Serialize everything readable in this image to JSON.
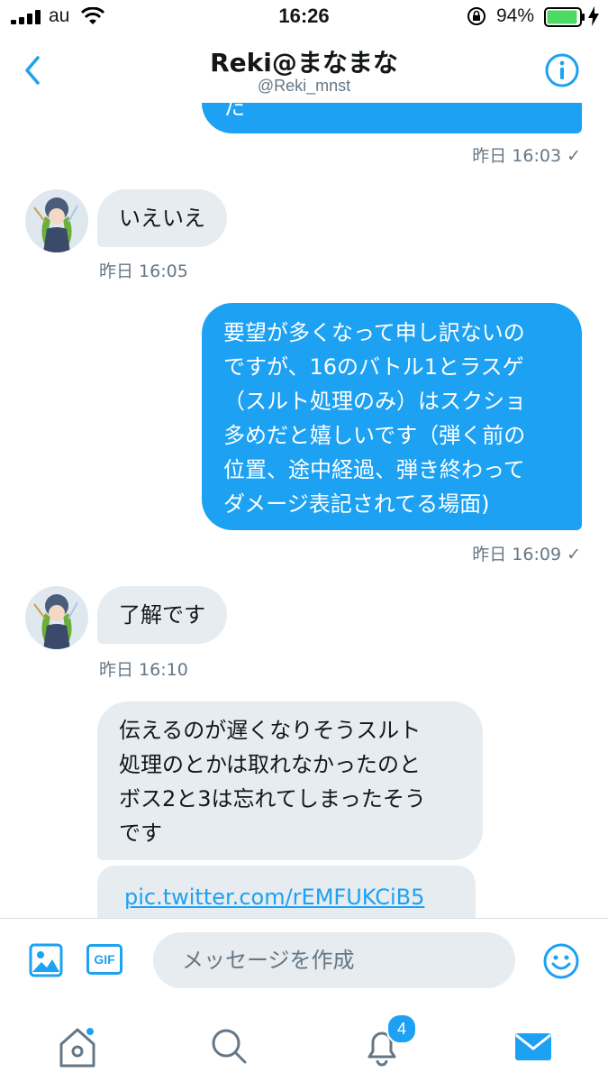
{
  "status_bar": {
    "carrier": "au",
    "time": "16:26",
    "battery_percent": "94%",
    "battery_level": 0.94
  },
  "header": {
    "title": "Reki@まなまな",
    "handle": "@Reki_mnst"
  },
  "messages": [
    {
      "from": "me",
      "text": "た",
      "time": "昨日 16:03 ✓"
    },
    {
      "from": "them",
      "text": "いえいえ",
      "time": "昨日 16:05"
    },
    {
      "from": "me",
      "lines": [
        "要望が多くなって申し訳ないの",
        "ですが、16のバトル1とラスゲ",
        "（スルト処理のみ）はスクショ",
        "多めだと嬉しいです（弾く前の",
        "位置、途中経過、弾き終わって",
        "ダメージ表記されてる場面)"
      ],
      "time": "昨日 16:09 ✓"
    },
    {
      "from": "them",
      "text": "了解です",
      "time": "昨日 16:10"
    },
    {
      "from": "them",
      "lines": [
        "伝えるのが遅くなりそうスルト",
        "処理のとかは取れなかったのと",
        "ボス2と3は忘れてしまったそう",
        "です"
      ]
    },
    {
      "from": "them",
      "link": "pic.twitter.com/rEMFUKCiB5"
    }
  ],
  "composer": {
    "placeholder": "メッセージを作成",
    "gif_label": "GIF"
  },
  "tabs": {
    "notifications_badge": "4"
  },
  "colors": {
    "accent": "#1da1f2",
    "received_bubble": "#e6ecf0",
    "meta_text": "#657786"
  }
}
